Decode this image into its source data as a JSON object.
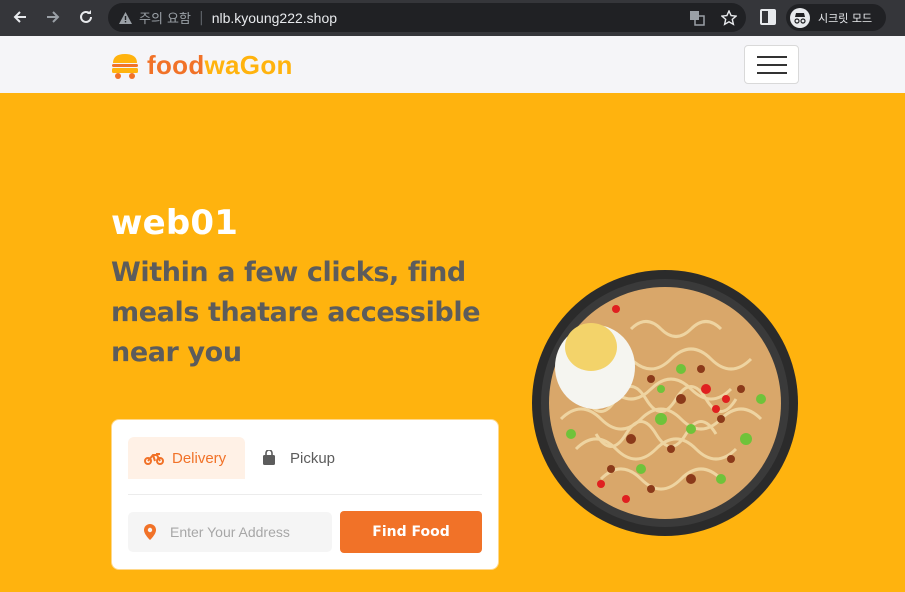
{
  "browser": {
    "security_text": "주의 요함",
    "url": "nlb.kyoung222.shop",
    "incognito_label": "시크릿 모드"
  },
  "header": {
    "logo_part1": "food",
    "logo_part2": "waGon"
  },
  "hero": {
    "title": "web01",
    "subtitle": "Within a few clicks, find meals thatare accessible near you"
  },
  "search_card": {
    "tabs": [
      {
        "label": "Delivery",
        "icon": "motorcycle-icon",
        "active": true
      },
      {
        "label": "Pickup",
        "icon": "shopping-bag-icon",
        "active": false
      }
    ],
    "address_placeholder": "Enter Your Address",
    "find_button": "Find Food"
  },
  "colors": {
    "brand_orange": "#f17228",
    "brand_yellow": "#ffb30e",
    "hero_text": "#5c5c5c"
  }
}
